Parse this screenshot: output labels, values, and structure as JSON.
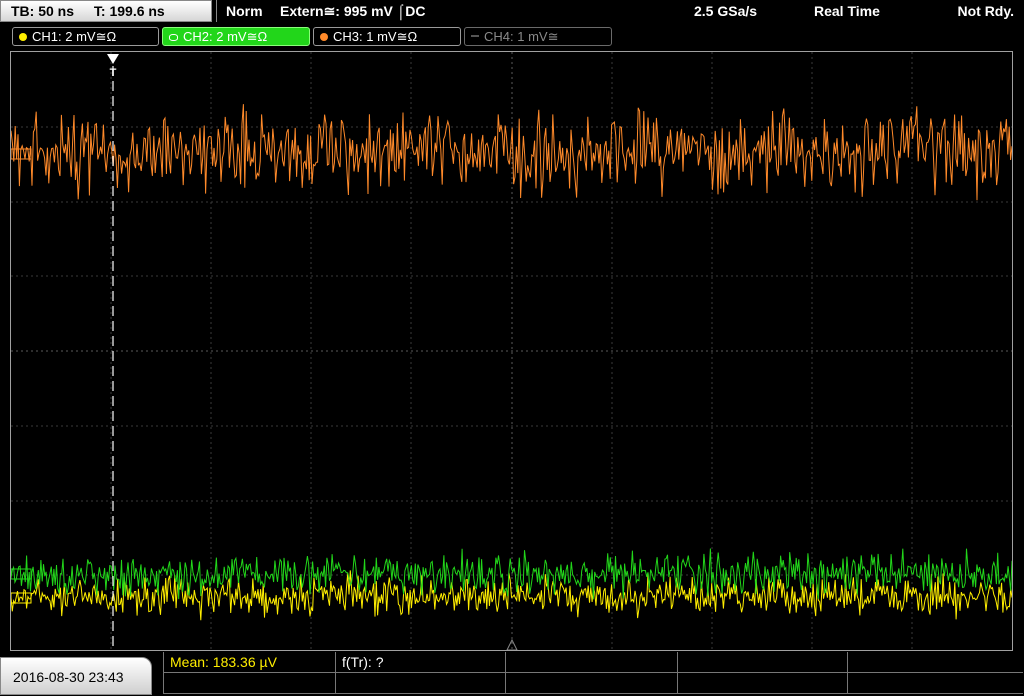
{
  "topbar": {
    "timebase": "TB: 50 ns",
    "trigger_time": "T: 199.6 ns",
    "mode": "Norm",
    "trigger_source": "Extern≅: 995 mV ⌠DC",
    "sample_rate": "2.5 GSa/s",
    "acq_mode": "Real Time",
    "status": "Not Rdy."
  },
  "channels": [
    {
      "label": "CH1: 2 mV≅Ω",
      "color": "#ffee00",
      "active": false
    },
    {
      "label": "CH2: 2 mV≅Ω",
      "color": "#22d61a",
      "active": true
    },
    {
      "label": "CH3: 1 mV≅Ω",
      "color": "#ff8a2a",
      "active": false
    },
    {
      "label": "CH4: 1 mV≅",
      "color": "#555555",
      "active": false
    }
  ],
  "marker": {
    "trigger_label": "T"
  },
  "measurements": {
    "mean": "Mean: 183.36 µV",
    "f_tr": "f(Tr): ?"
  },
  "datetime": "2016-08-30 23:43"
}
